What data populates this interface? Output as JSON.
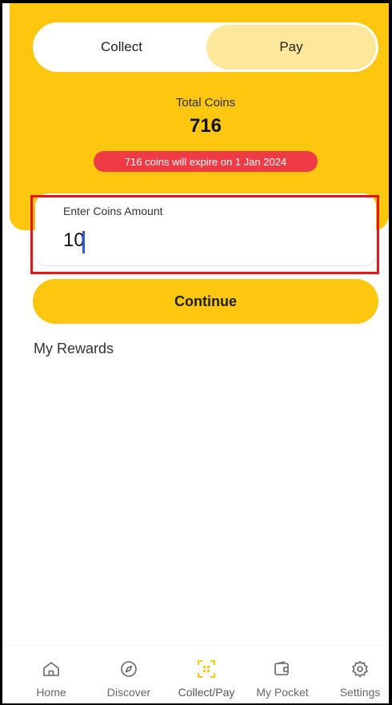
{
  "toggle": {
    "collect_label": "Collect",
    "pay_label": "Pay",
    "selected": "Pay"
  },
  "coins": {
    "total_label": "Total Coins",
    "total_value": "716",
    "expire_notice": "716 coins will expire on 1 Jan 2024"
  },
  "amount": {
    "label": "Enter Coins Amount",
    "value": "10"
  },
  "continue_label": "Continue",
  "rewards_title": "My Rewards",
  "nav": {
    "items": [
      {
        "label": "Home",
        "icon": "home-icon"
      },
      {
        "label": "Discover",
        "icon": "compass-icon"
      },
      {
        "label": "Collect/Pay",
        "icon": "scan-icon"
      },
      {
        "label": "My Pocket",
        "icon": "wallet-icon"
      },
      {
        "label": "Settings",
        "icon": "gear-icon"
      }
    ],
    "active": "Collect/Pay"
  },
  "colors": {
    "accent": "#fdc60f",
    "accent_light": "#fde79a",
    "badge_red": "#ef3b45",
    "highlight_red": "#e4161c",
    "caret_blue": "#2a5bd7"
  }
}
